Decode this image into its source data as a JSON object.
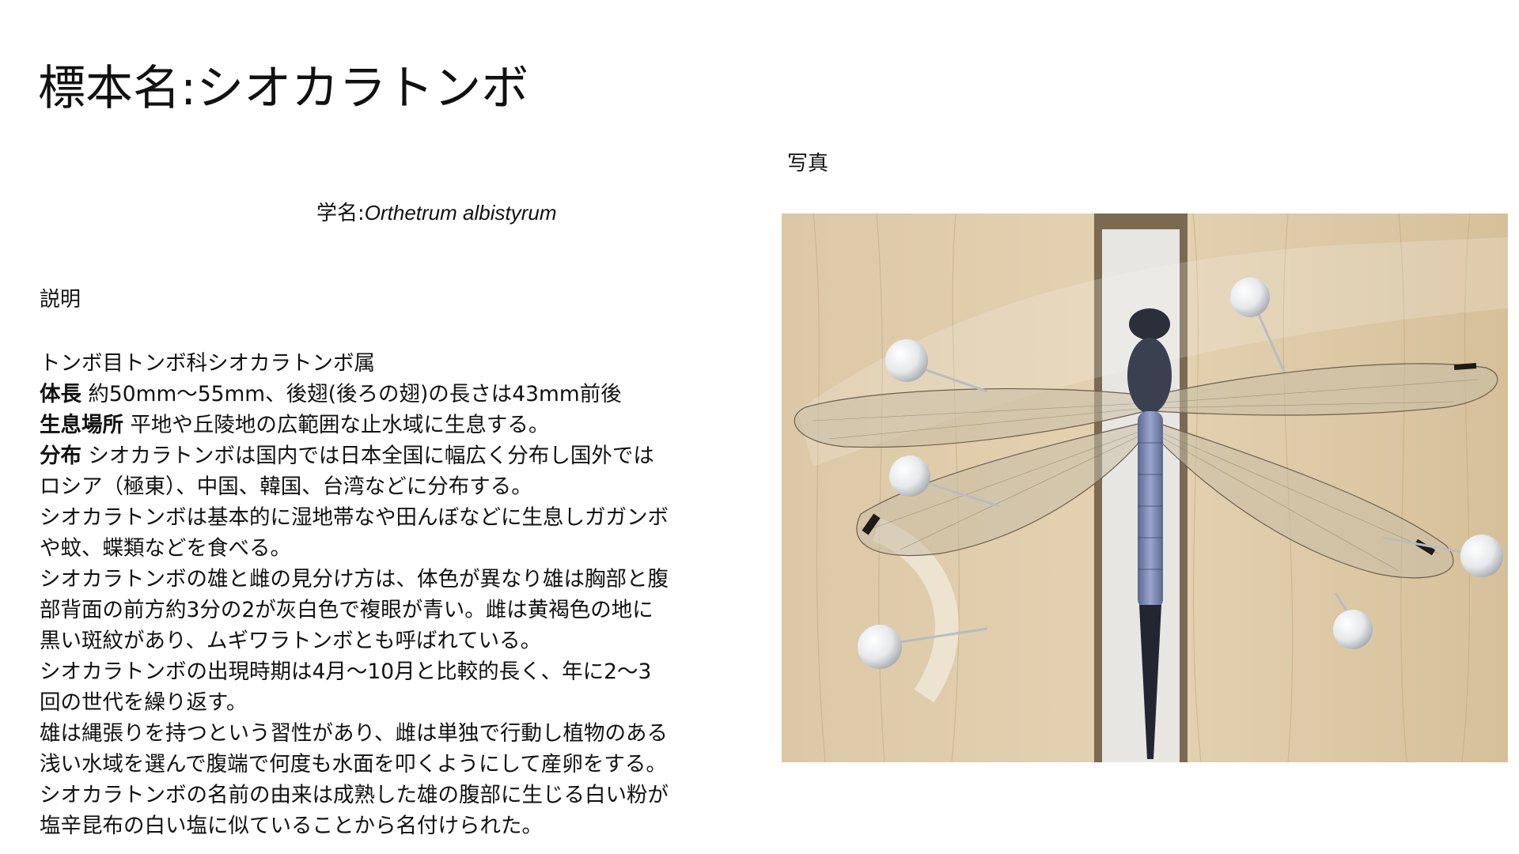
{
  "title": "標本名:シオカラトンボ",
  "scientific_name": {
    "prefix": "学名:",
    "latin": "Orthetrum albistyrum"
  },
  "description": {
    "heading": "説明",
    "classification": "トンボ目トンボ科シオカラトンボ属",
    "body_length": {
      "label": "体長",
      "text": " 約50mm〜55mm、後翅(後ろの翅)の長さは43mm前後"
    },
    "habitat": {
      "label": "生息場所",
      "text": " 平地や丘陵地の広範囲な止水域に生息する。"
    },
    "distribution": {
      "label": "分布",
      "text_line1": " シオカラトンボは国内では日本全国に幅広く分布し国外では",
      "text_line2": "ロシア（極東）、中国、韓国、台湾などに分布する。"
    },
    "paragraphs": [
      "シオカラトンボは基本的に湿地帯なや田んぼなどに生息しガガンボ",
      "や蚊、蝶類などを食べる。",
      "シオカラトンボの雄と雌の見分け方は、体色が異なり雄は胸部と腹",
      "部背面の前方約3分の2が灰白色で複眼が青い。雌は黄褐色の地に",
      "黒い斑紋があり、ムギワラトンボとも呼ばれている。",
      "シオカラトンボの出現時期は4月〜10月と比較的長く、年に2〜3",
      "回の世代を繰り返す。",
      "雄は縄張りを持つという習性があり、雌は単独で行動し植物のある",
      "浅い水域を選んで腹端で何度も水面を叩くようにして産卵をする。",
      "シオカラトンボの名前の由来は成熟した雄の腹部に生じる白い粉が",
      "塩辛昆布の白い塩に似ていることから名付けられた。"
    ]
  },
  "photo": {
    "label": "写真",
    "subject": "pinned-dragonfly-specimen"
  }
}
